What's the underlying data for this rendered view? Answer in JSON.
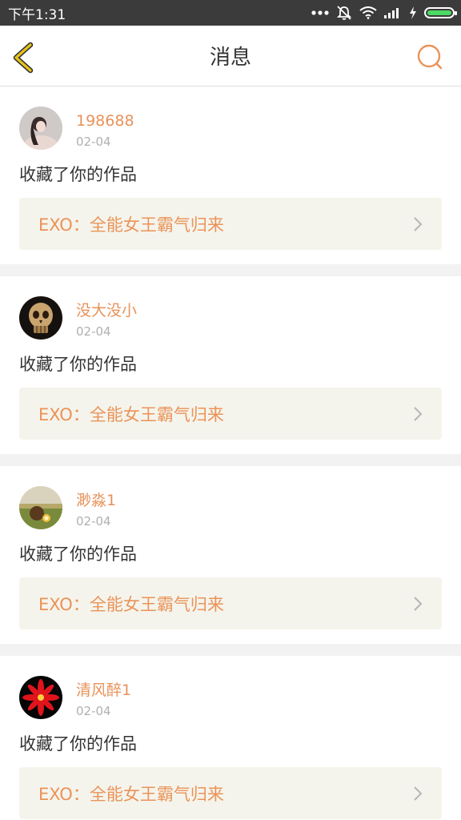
{
  "status": {
    "time": "下午1:31"
  },
  "header": {
    "title": "消息"
  },
  "colors": {
    "accent": "#ea9358",
    "back_icon": "#e7c21a",
    "link_bg": "#f5f4ec"
  },
  "icons": {
    "back": "chevron-left-icon",
    "search": "search-icon",
    "row_arrow": "chevron-right-icon"
  },
  "messages": [
    {
      "user": "198688",
      "date": "02-04",
      "action": "收藏了你的作品",
      "work": "EXO：全能女王霸气归来"
    },
    {
      "user": "没大没小",
      "date": "02-04",
      "action": "收藏了你的作品",
      "work": "EXO：全能女王霸气归来"
    },
    {
      "user": "渺淼1",
      "date": "02-04",
      "action": "收藏了你的作品",
      "work": "EXO：全能女王霸气归来"
    },
    {
      "user": "清风醉1",
      "date": "02-04",
      "action": "收藏了你的作品",
      "work": "EXO：全能女王霸气归来"
    }
  ]
}
